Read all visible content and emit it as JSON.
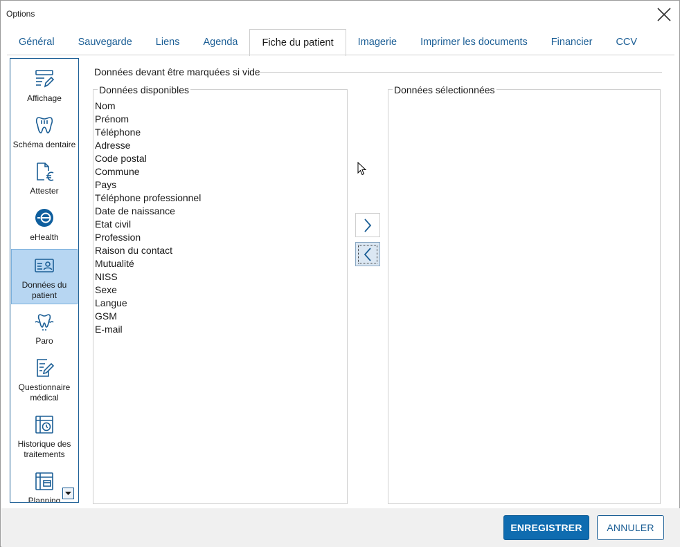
{
  "window": {
    "title": "Options"
  },
  "tabs": [
    {
      "label": "Général"
    },
    {
      "label": "Sauvegarde"
    },
    {
      "label": "Liens"
    },
    {
      "label": "Agenda"
    },
    {
      "label": "Fiche du patient",
      "active": true
    },
    {
      "label": "Imagerie"
    },
    {
      "label": "Imprimer les documents"
    },
    {
      "label": "Financier"
    },
    {
      "label": "CCV"
    }
  ],
  "sidebar": {
    "items": [
      {
        "label": "Affichage",
        "icon": "display-settings-icon"
      },
      {
        "label": "Schéma dentaire",
        "icon": "tooth-icon"
      },
      {
        "label": "Attester",
        "icon": "euro-document-icon"
      },
      {
        "label": "eHealth",
        "icon": "ehealth-icon"
      },
      {
        "label": "Données du patient",
        "icon": "patient-card-icon",
        "active": true
      },
      {
        "label": "Paro",
        "icon": "gum-tooth-icon"
      },
      {
        "label": "Questionnaire médical",
        "icon": "questionnaire-icon"
      },
      {
        "label": "Historique des traitements",
        "icon": "treatment-history-icon"
      },
      {
        "label": "Planning",
        "icon": "calendar-icon"
      }
    ]
  },
  "section": {
    "title": "Données devant être marquées si vide"
  },
  "available": {
    "legend": "Données disponibles",
    "items": [
      "Nom",
      "Prénom",
      "Téléphone",
      "Adresse",
      "Code postal",
      "Commune",
      "Pays",
      "Téléphone professionnel",
      "Date de naissance",
      "Etat civil",
      "Profession",
      "Raison du contact",
      "Mutualité",
      "NISS",
      "Sexe",
      "Langue",
      "GSM",
      "E-mail"
    ]
  },
  "selected": {
    "legend": "Données sélectionnées",
    "items": []
  },
  "buttons": {
    "save": "ENREGISTRER",
    "cancel": "ANNULER"
  },
  "colors": {
    "accent": "#0f6cb0",
    "tab_text": "#1b5e95",
    "active_sidebar": "#b7d6f2"
  }
}
